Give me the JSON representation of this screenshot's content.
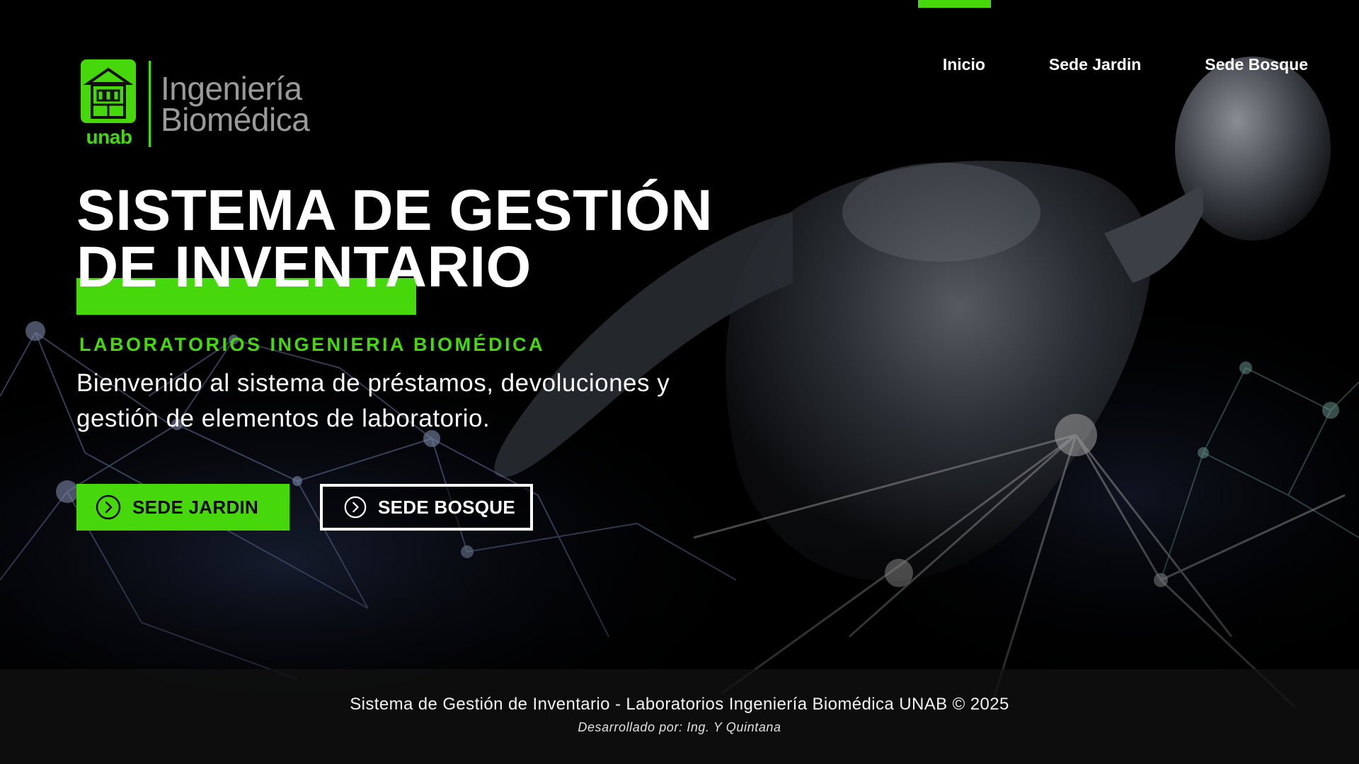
{
  "brand": {
    "logo_short": "unab",
    "logo_line1": "Ingeniería",
    "logo_line2": "Biomédica",
    "accent_color": "#46d80a"
  },
  "nav": {
    "items": [
      {
        "label": "Inicio"
      },
      {
        "label": "Sede Jardin"
      },
      {
        "label": "Sede Bosque"
      }
    ]
  },
  "hero": {
    "title_line1": "SISTEMA DE GESTIÓN",
    "title_line2": "DE INVENTARIO",
    "subtitle": "LABORATORIOS INGENIERIA BIOMÉDICA",
    "description_line1": "Bienvenido al sistema de préstamos, devoluciones y",
    "description_line2": "gestión de elementos de laboratorio."
  },
  "buttons": {
    "jardin": {
      "label": "SEDE JARDIN",
      "icon": "arrow-circle-right-icon"
    },
    "bosque": {
      "label": "SEDE BOSQUE",
      "icon": "arrow-circle-right-icon"
    }
  },
  "footer": {
    "main": "Sistema de Gestión de Inventario - Laboratorios Ingeniería Biomédica UNAB © 2025",
    "credit": "Desarrollado por: Ing. Y Quintana"
  }
}
